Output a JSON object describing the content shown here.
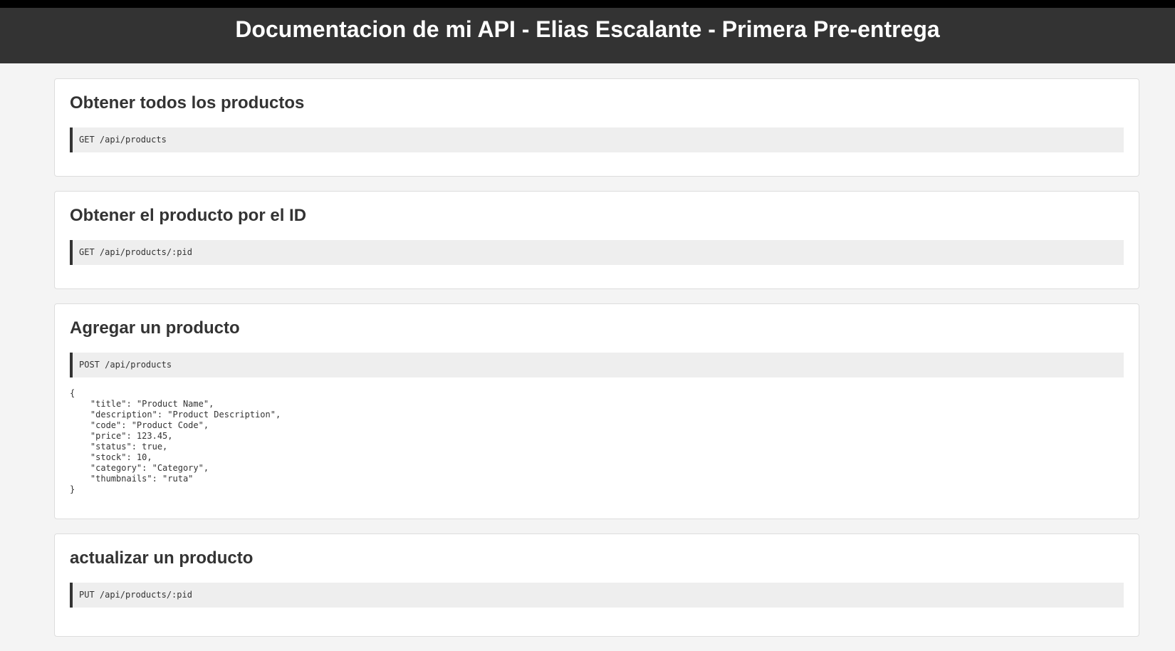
{
  "header": {
    "title": "Documentacion de mi API - Elias Escalante - Primera Pre-entrega"
  },
  "sections": [
    {
      "title": "Obtener todos los productos",
      "endpoint": "GET /api/products"
    },
    {
      "title": "Obtener el producto por el ID",
      "endpoint": "GET /api/products/:pid"
    },
    {
      "title": "Agregar un producto",
      "endpoint": "POST /api/products",
      "body": "{\n    \"title\": \"Product Name\",\n    \"description\": \"Product Description\",\n    \"code\": \"Product Code\",\n    \"price\": 123.45,\n    \"status\": true,\n    \"stock\": 10,\n    \"category\": \"Category\",\n    \"thumbnails\": \"ruta\"\n}"
    },
    {
      "title": "actualizar un producto",
      "endpoint": "PUT /api/products/:pid"
    }
  ],
  "colors": {
    "header_bg": "#333333",
    "header_text": "#ffffff",
    "page_bg": "#f4f4f4",
    "card_bg": "#ffffff",
    "code_bg": "#eeeeee",
    "code_border": "#333333"
  }
}
